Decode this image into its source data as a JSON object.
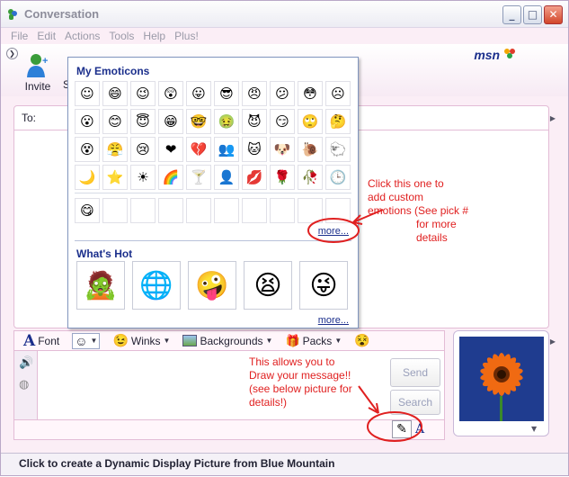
{
  "window": {
    "title": "Conversation",
    "controls": [
      "_",
      "□",
      "✕"
    ]
  },
  "menu": [
    "File",
    "Edit",
    "Actions",
    "Tools",
    "Help",
    "Plus!"
  ],
  "toolbar": {
    "invite_label": "Invite",
    "partial_label": "S",
    "brand": "msn"
  },
  "conversation": {
    "to_label": "To:"
  },
  "emoticons_popup": {
    "my_header": "My Emoticons",
    "rows": [
      [
        "☺",
        "😄",
        "😉",
        "😲",
        "😛",
        "😎",
        "😠",
        "😕",
        "😳",
        "☹"
      ],
      [
        "😮",
        "😊",
        "😇",
        "😁",
        "🤓",
        "🤢",
        "😈",
        "😏",
        "🙄",
        "🤔"
      ],
      [
        "😵",
        "😤",
        "😢",
        "❤",
        "💔",
        "👥",
        "🐱",
        "🐶",
        "🐌",
        "🐑"
      ],
      [
        "🌙",
        "⭐",
        "☀",
        "🌈",
        "🍸",
        "👤",
        "💋",
        "🌹",
        "🥀",
        "🕒"
      ]
    ],
    "custom_row": [
      "😋",
      "",
      "",
      "",
      "",
      "",
      "",
      "",
      "",
      ""
    ],
    "more_1": "more...",
    "hot_header": "What's Hot",
    "hot": [
      "🧟",
      "🌐",
      "🤪",
      "😫",
      "😜"
    ],
    "more_2": "more..."
  },
  "compose": {
    "font_label": "Font",
    "winks_label": "Winks",
    "backgrounds_label": "Backgrounds",
    "packs_label": "Packs",
    "send_label": "Send",
    "search_label": "Search"
  },
  "annotations": {
    "custom": [
      "Click this one to",
      "add custom",
      "emotions (See pick #",
      "for more",
      "details"
    ],
    "draw": [
      "This allows you to",
      "Draw your message!!",
      "(see below picture for",
      "details!)"
    ]
  },
  "status_text": "Click to create a Dynamic Display Picture from Blue Mountain",
  "colors": {
    "accent": "#1b2f8c",
    "annotation": "#e02020",
    "window_bg": "#fbeef6"
  }
}
